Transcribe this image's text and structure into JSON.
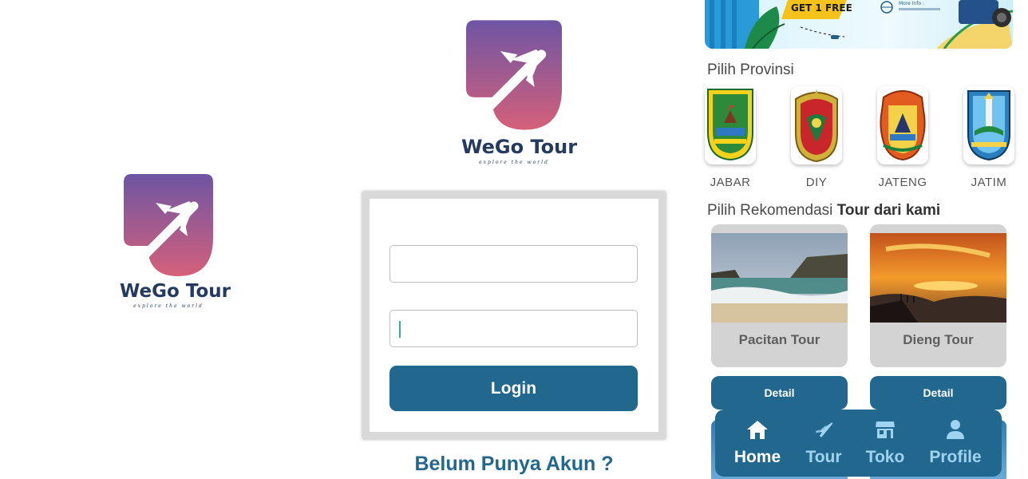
{
  "splash": {
    "brand": "WeGo Tour",
    "tagline": "explore the world"
  },
  "login": {
    "brand": "WeGo Tour",
    "tagline": "explore the world",
    "username": {
      "value": "",
      "placeholder": ""
    },
    "password": {
      "value": "",
      "placeholder": ""
    },
    "login_label": "Login",
    "register_label": "Belum Punya Akun ?"
  },
  "home": {
    "banner": {
      "promo": "GET 1 FREE",
      "more_info": "More Info :"
    },
    "provinces_title": "Pilih Provinsi",
    "provinces": [
      {
        "label": "JABAR",
        "icon": "jabar-emblem-icon"
      },
      {
        "label": "DIY",
        "icon": "diy-emblem-icon"
      },
      {
        "label": "JATENG",
        "icon": "jateng-emblem-icon"
      },
      {
        "label": "JATIM",
        "icon": "jatim-emblem-icon"
      }
    ],
    "recommend_title_prefix": "Pilih Rekomendasi ",
    "recommend_title_bold": "Tour dari kami",
    "tours": [
      {
        "name": "Pacitan Tour",
        "detail_label": "Detail"
      },
      {
        "name": "Dieng Tour",
        "detail_label": "Detail"
      }
    ],
    "nav": [
      {
        "label": "Home",
        "icon": "home-icon",
        "active": true
      },
      {
        "label": "Tour",
        "icon": "plane-icon",
        "active": false
      },
      {
        "label": "Toko",
        "icon": "store-icon",
        "active": false
      },
      {
        "label": "Profile",
        "icon": "person-icon",
        "active": false
      }
    ],
    "colors": {
      "primary": "#22678d",
      "nav_inactive": "#9ed3f1",
      "logo_top": "#6e55a3",
      "logo_bottom": "#d4607a"
    }
  }
}
